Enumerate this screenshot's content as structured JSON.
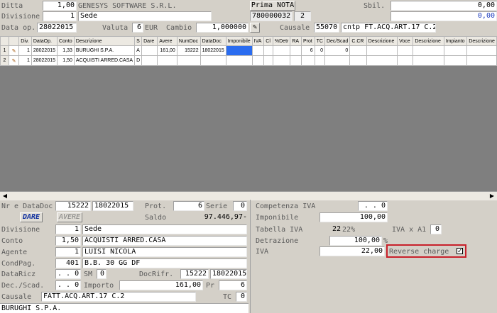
{
  "header": {
    "ditta_label": "Ditta",
    "ditta_value": "1,00",
    "ditta_name": "GENESYS SOFTWARE S.R.L.",
    "prima_nota": "Prima NOTA",
    "sbil_label": "Sbil.",
    "sbil_value1": "0,00",
    "sbil_value2": "0,00",
    "divisione_label": "Divisione",
    "divisione_value": "1",
    "divisione_name": "Sede",
    "doc_num": "780000032",
    "doc_seq": "2",
    "data_op_label": "Data op.",
    "data_op_value": "28022015",
    "valuta_label": "Valuta",
    "valuta_num": "6",
    "valuta_code": "EUR",
    "cambio_label": "Cambio",
    "cambio_value": "1,000000",
    "causale_label": "Causale",
    "causale_code": "55070",
    "causale_desc": "cntp FT.ACQ.ART.17 C.2"
  },
  "grid": {
    "headers": [
      "",
      "",
      "Div.",
      "DataOp.",
      "Conto",
      "Descrizione",
      "S",
      "Dare",
      "Avere",
      "NumDoc",
      "DataDoc",
      "Imponibile",
      "IVA",
      "Cl",
      "%Detr",
      "RA",
      "Prot",
      "TC",
      "Dec/Scad",
      "C.CR",
      "Descrizione",
      "Voce",
      "Descrizione",
      "Impianto",
      "Descrizione"
    ],
    "rows": [
      {
        "n": "1",
        "div": "1",
        "data": "28022015",
        "conto": "1,33",
        "desc": "BURUGHI S.P.A.",
        "s": "A",
        "dare": "",
        "avere": "161,00",
        "numdoc": "15222",
        "datadoc": "18022015",
        "prot": "6",
        "tc": "0",
        "decscad": "0"
      },
      {
        "n": "2",
        "div": "1",
        "data": "28022015",
        "conto": "1,50",
        "desc": "ACQUISTI ARRED.CASA",
        "s": "D",
        "dare": "",
        "avere": "",
        "numdoc": "",
        "datadoc": "",
        "prot": "",
        "tc": "",
        "decscad": ""
      }
    ]
  },
  "detail": {
    "nr_datadoc_label": "Nr e DataDoc",
    "nr_doc": "15222",
    "data_doc": "18022015",
    "prot_label": "Prot.",
    "prot_value": "6",
    "serie_label": "Serie",
    "serie_value": "0",
    "dare_btn": "DARE",
    "avere_btn": "AVERE",
    "saldo_label": "Saldo",
    "saldo_value": "97.446,97-",
    "divisione_label": "Divisione",
    "divisione_value": "1",
    "divisione_name": "Sede",
    "conto_label": "Conto",
    "conto_value": "1,50",
    "conto_name": "ACQUISTI ARRED.CASA",
    "agente_label": "Agente",
    "agente_value": "1",
    "agente_name": "LUISI NICOLA",
    "condpag_label": "CondPag.",
    "condpag_value": "401",
    "condpag_name": "B.B. 30 GG DF",
    "dataricz_label": "DataRicz",
    "dataricz_value": ". . 0",
    "sm_label": "SM",
    "sm_value": "0",
    "docrifr_label": "DocRifr.",
    "docrifr_num": "15222",
    "docrifr_date": "18022015",
    "decscad_label": "Dec./Scad.",
    "decscad_value": ". . 0",
    "importo_label": "Importo",
    "importo_value": "161,00",
    "pr_label": "Pr",
    "pr_value": "6",
    "causale_label": "Causale",
    "causale_value": "FATT.ACQ.ART.17 C.2",
    "tc_label": "TC",
    "tc_value": "0",
    "footer_name": "BURUGHI S.P.A."
  },
  "iva": {
    "competenza_label": "Competenza IVA",
    "competenza_value": ". . 0",
    "imponibile_label": "Imponibile",
    "imponibile_value": "100,00",
    "tabella_label": "Tabella IVA",
    "tabella_value": "22",
    "tabella_pct": "22%",
    "ivaxa1_label": "IVA x A1",
    "ivaxa1_value": "0",
    "detrazione_label": "Detrazione",
    "detrazione_value": "100,00",
    "detrazione_unit": "%",
    "iva_label": "IVA",
    "iva_value": "22,00",
    "reverse_label": "Reverse charge",
    "reverse_checked": "✓"
  }
}
